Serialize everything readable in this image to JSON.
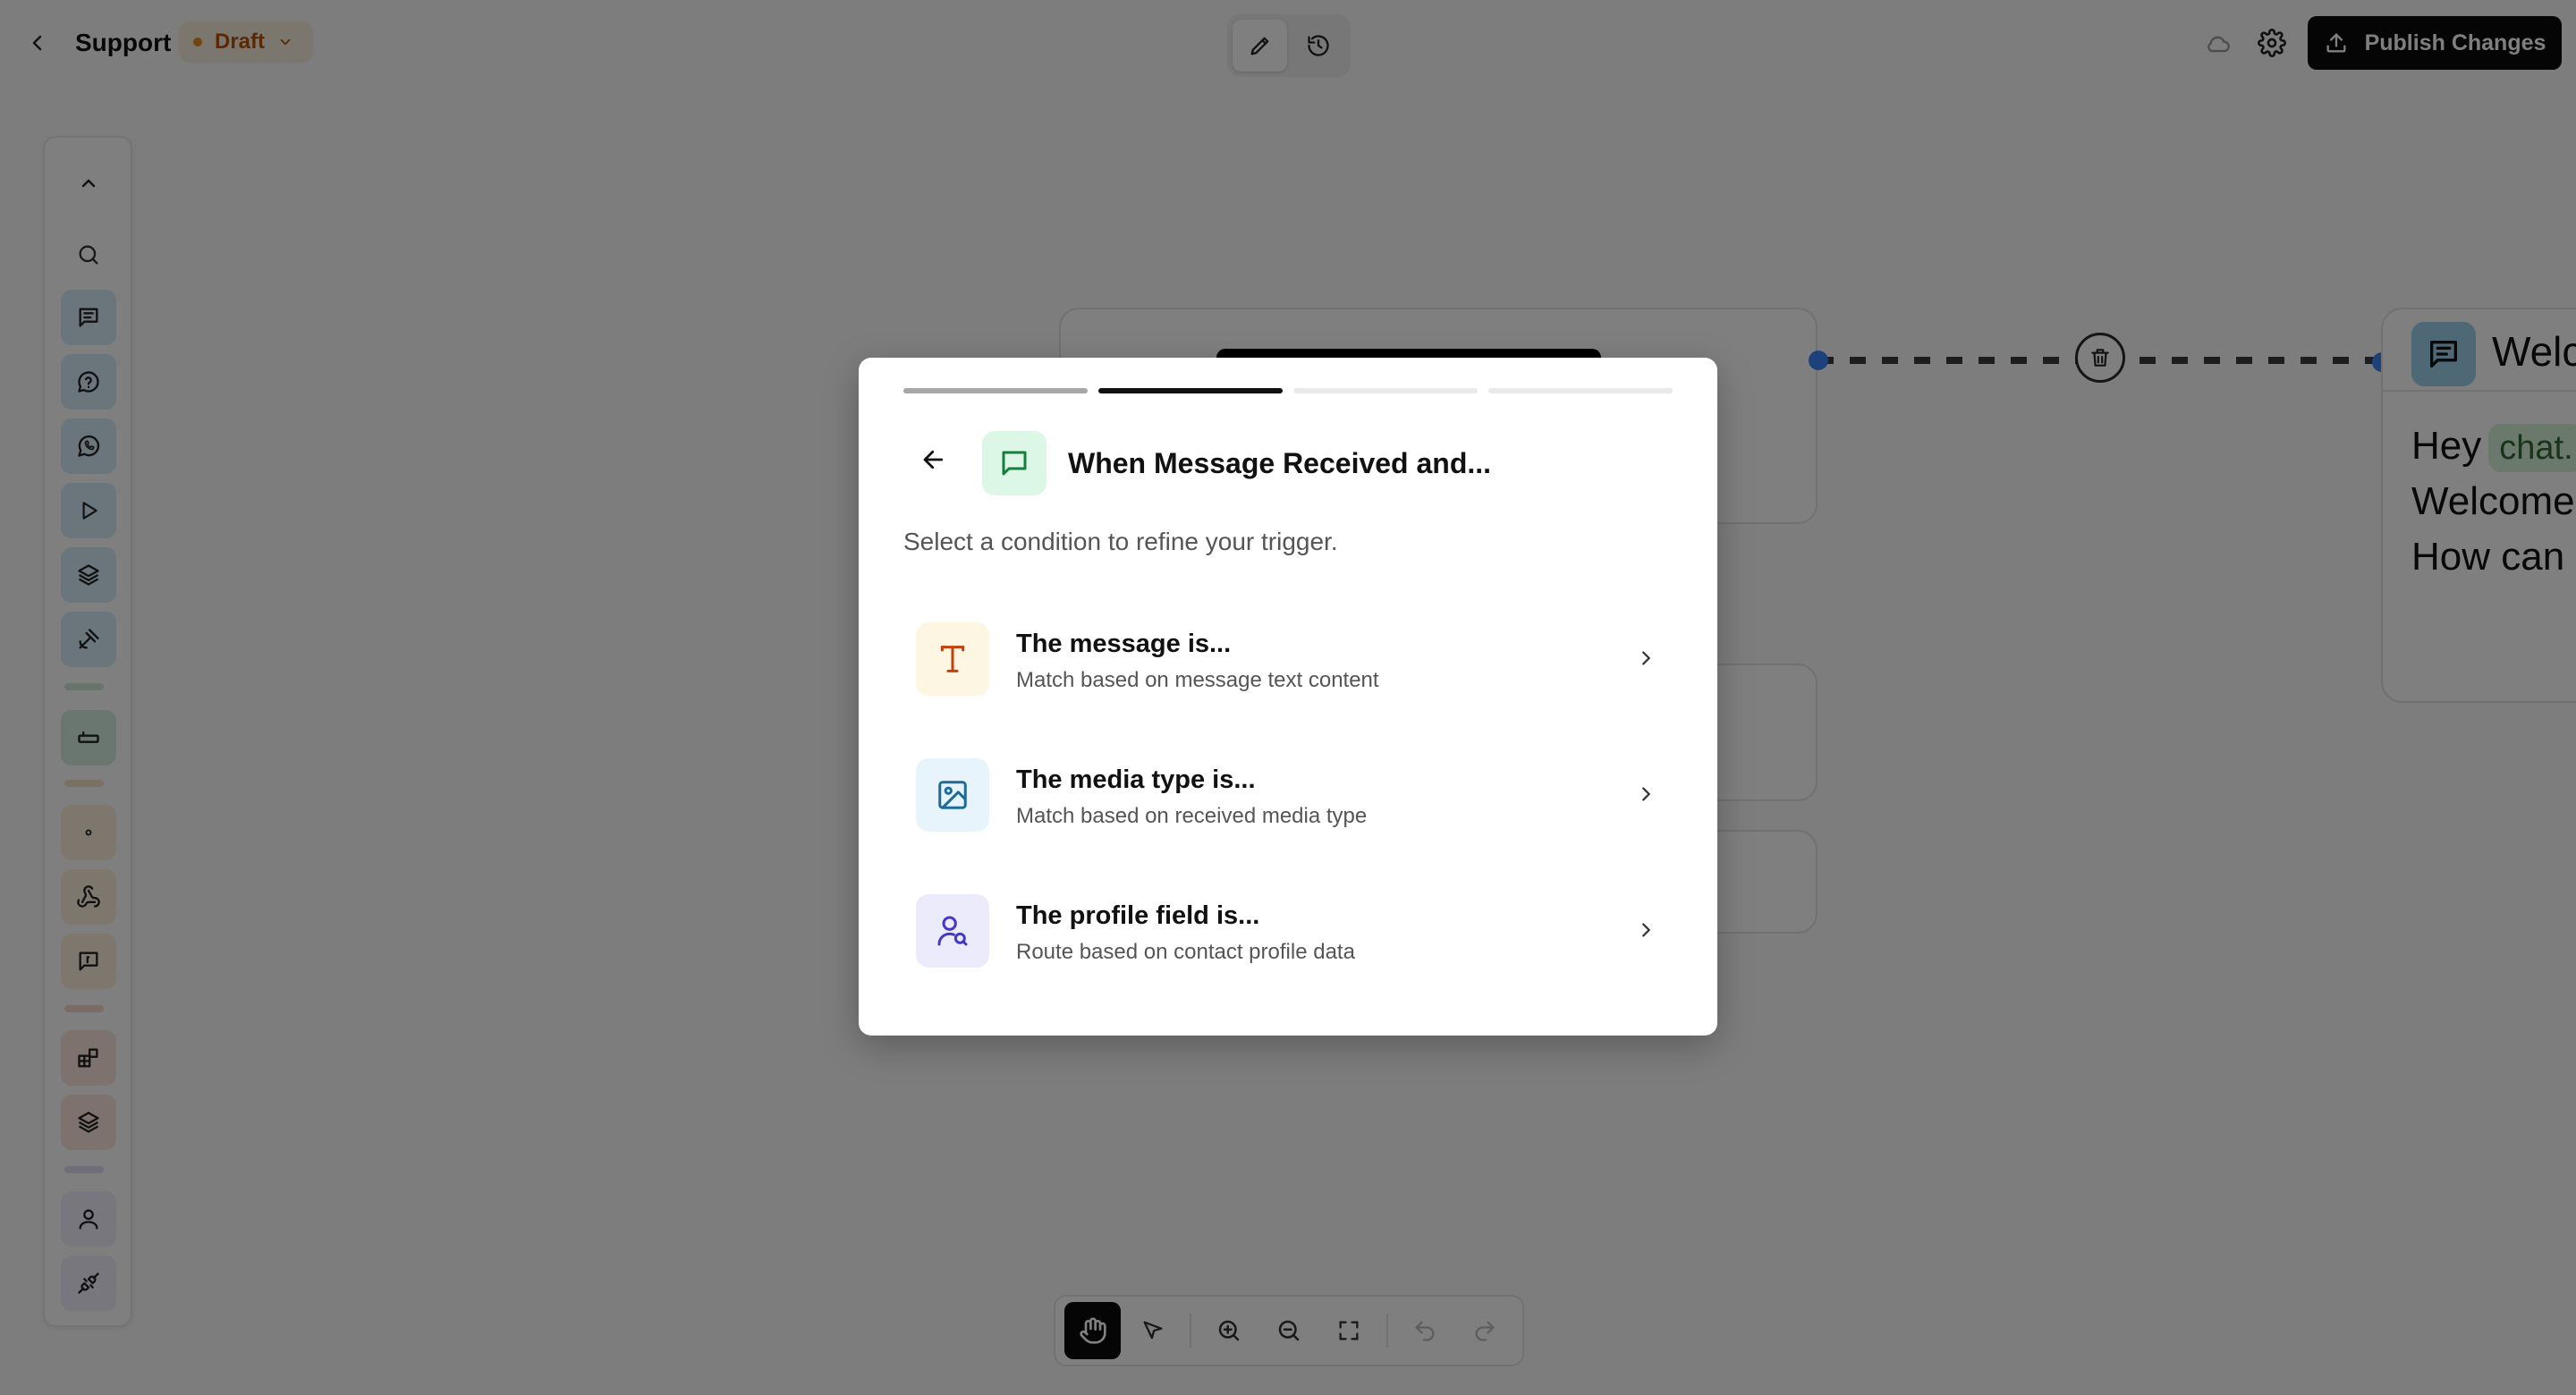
{
  "header": {
    "back_icon": "chevron-left-icon",
    "flow_name": "Support",
    "status": "Draft",
    "mode_buttons": [
      "pencil-icon",
      "history-icon"
    ],
    "publish_label": "Publish Changes"
  },
  "sidebar": {
    "items": [
      "chevron-up-icon",
      "search-icon",
      "message-square-icon",
      "message-circle-question-icon",
      "whatsapp-icon",
      "play-icon",
      "layers-icon",
      "pen-tool-icon",
      "input-icon",
      "dot-icon",
      "webhook-icon",
      "message-square-text-icon",
      "blocks-icon",
      "layers-icon",
      "user-icon",
      "plug-icon"
    ]
  },
  "canvas": {
    "message_node": {
      "title": "Welco",
      "greeting": "Hey",
      "variable_chip": "chat.",
      "line2": "Welcome",
      "line3": "How can"
    }
  },
  "bottom_toolbar": {
    "tools": [
      "hand-icon",
      "pointer-icon",
      "zoom-in-icon",
      "zoom-out-icon",
      "fullscreen-icon",
      "undo-icon",
      "redo-icon"
    ]
  },
  "modal": {
    "step": 2,
    "total_steps": 4,
    "title": "When Message Received and...",
    "subtitle": "Select a condition to refine your trigger.",
    "options": [
      {
        "title": "The message is...",
        "description": "Match based on message text content",
        "icon": "text-icon",
        "icon_bg": "#fdf6e3",
        "icon_color": "#c2410c"
      },
      {
        "title": "The media type is...",
        "description": "Match based on received media type",
        "icon": "image-icon",
        "icon_bg": "#e8f4fb",
        "icon_color": "#1e6a9a"
      },
      {
        "title": "The profile field is...",
        "description": "Route based on contact profile data",
        "icon": "user-search-icon",
        "icon_bg": "#ecebfb",
        "icon_color": "#4338ca"
      }
    ]
  },
  "colors": {
    "accent_dark": "#0a0a0a",
    "edge_dot": "#3b82f6",
    "draft_text": "#b45309"
  }
}
